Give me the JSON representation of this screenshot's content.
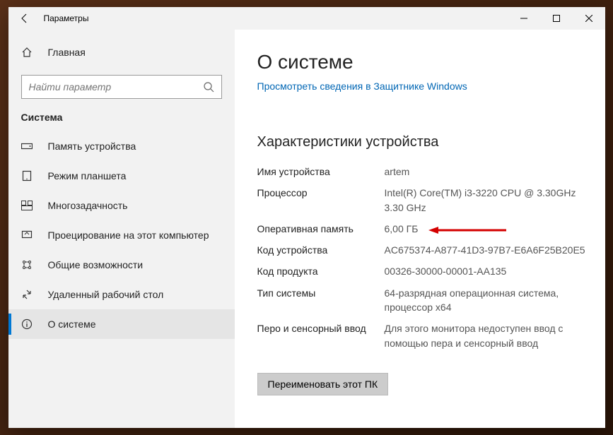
{
  "window": {
    "title": "Параметры"
  },
  "sidebar": {
    "home_label": "Главная",
    "search_placeholder": "Найти параметр",
    "section_label": "Система",
    "items": [
      {
        "label": "Память устройства"
      },
      {
        "label": "Режим планшета"
      },
      {
        "label": "Многозадачность"
      },
      {
        "label": "Проецирование на этот компьютер"
      },
      {
        "label": "Общие возможности"
      },
      {
        "label": "Удаленный рабочий стол"
      },
      {
        "label": "О системе",
        "active": true
      }
    ]
  },
  "content": {
    "heading": "О системе",
    "defender_link": "Просмотреть сведения в Защитнике Windows",
    "specs_heading": "Характеристики устройства",
    "specs": [
      {
        "label": "Имя устройства",
        "value": "artem"
      },
      {
        "label": "Процессор",
        "value": "Intel(R) Core(TM) i3-3220 CPU @ 3.30GHz   3.30 GHz"
      },
      {
        "label": "Оперативная память",
        "value": "6,00 ГБ",
        "highlight": true
      },
      {
        "label": "Код устройства",
        "value": "AC675374-A877-41D3-97B7-E6A6F25B20E5"
      },
      {
        "label": "Код продукта",
        "value": "00326-30000-00001-AA135"
      },
      {
        "label": "Тип системы",
        "value": "64-разрядная операционная система, процессор x64"
      },
      {
        "label": "Перо и сенсорный ввод",
        "value": "Для этого монитора недоступен ввод с помощью пера и сенсорный ввод"
      }
    ],
    "rename_button": "Переименовать этот ПК"
  }
}
